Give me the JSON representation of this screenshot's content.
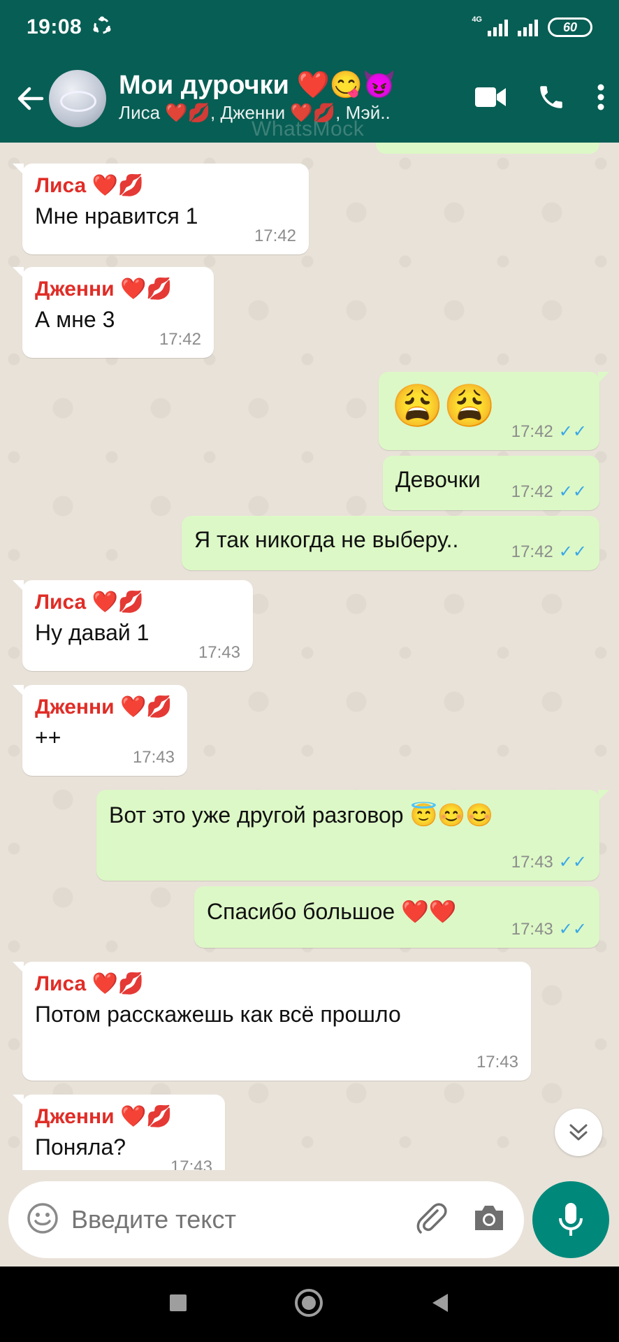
{
  "status": {
    "time": "19:08",
    "network": "4G",
    "battery": "60"
  },
  "header": {
    "title": "Мои дурочки ❤️😋😈",
    "subtitle": "Лиса ❤️💋, Дженни ❤️💋, Мэй..",
    "watermark": "WhatsMock"
  },
  "messages": [
    {
      "sender": "Лиса ❤️💋",
      "text": "Мне нравится 1",
      "time": "17:42"
    },
    {
      "sender": "Дженни ❤️💋",
      "text": "А мне 3",
      "time": "17:42"
    },
    {
      "text": "😩😩",
      "time": "17:42"
    },
    {
      "text": "Девочки",
      "time": "17:42"
    },
    {
      "text": "Я так никогда не выберу..",
      "time": "17:42"
    },
    {
      "sender": "Лиса ❤️💋",
      "text": "Ну давай 1",
      "time": "17:43"
    },
    {
      "sender": "Дженни ❤️💋",
      "text": "++",
      "time": "17:43"
    },
    {
      "text": "Вот это уже другой разговор 😇😊😊",
      "time": "17:43"
    },
    {
      "text": "Спасибо большое ❤️❤️",
      "time": "17:43"
    },
    {
      "sender": "Лиса ❤️💋",
      "text": "Потом расскажешь как всё прошло",
      "time": "17:43"
    },
    {
      "sender": "Дженни ❤️💋",
      "text": "Поняла?",
      "time": "17:43"
    }
  ],
  "composer": {
    "placeholder": "Введите текст"
  },
  "colors": {
    "header": "#075e54",
    "outgoing": "#dcf8c6",
    "incoming": "#ffffff",
    "sender": "#e02d27",
    "mic": "#00897b"
  }
}
